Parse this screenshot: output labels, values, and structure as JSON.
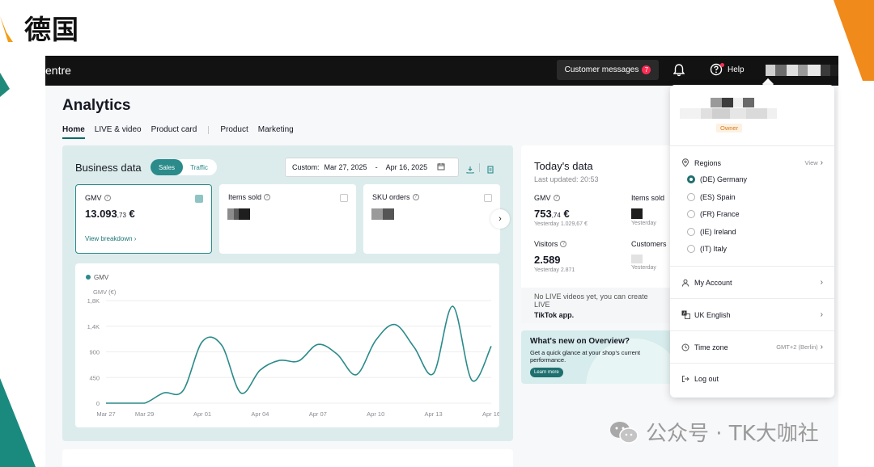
{
  "slide": {
    "title": "德国",
    "watermark": "公众号 · TK大咖社"
  },
  "topbar": {
    "brand_fragment": "entre",
    "customer_messages": "Customer messages",
    "message_count": "7",
    "help": "Help"
  },
  "page": {
    "title": "Analytics",
    "tabs": [
      {
        "label": "Home",
        "active": true
      },
      {
        "label": "LIVE & video",
        "active": false
      },
      {
        "label": "Product card",
        "active": false
      },
      {
        "label": "Product",
        "active": false
      },
      {
        "label": "Marketing",
        "active": false
      }
    ]
  },
  "business": {
    "title": "Business data",
    "toggle": [
      "Sales",
      "Traffic"
    ],
    "date_prefix": "Custom:",
    "date_start": "Mar 27, 2025",
    "date_sep": "-",
    "date_end": "Apr 16, 2025",
    "metrics": [
      {
        "label": "GMV",
        "value_main": "13.093",
        "value_dec": ",73",
        "value_unit": " €",
        "link": "View breakdown ›",
        "selected": true
      },
      {
        "label": "Items sold",
        "selected": false
      },
      {
        "label": "SKU orders",
        "selected": false
      }
    ]
  },
  "chart_data": {
    "type": "line",
    "legend": "GMV",
    "ylabel": "GMV (€)",
    "ylim": [
      0,
      1800
    ],
    "yticks": [
      "0",
      "450",
      "900",
      "1,4K",
      "1,8K"
    ],
    "ytick_values": [
      0,
      450,
      900,
      1350,
      1800
    ],
    "xticks": [
      "Mar 27",
      "Mar 29",
      "Apr 01",
      "Apr 04",
      "Apr 07",
      "Apr 10",
      "Apr 13",
      "Apr 16"
    ],
    "x": [
      "Mar 27",
      "Mar 28",
      "Mar 29",
      "Mar 30",
      "Mar 31",
      "Apr 01",
      "Apr 02",
      "Apr 03",
      "Apr 04",
      "Apr 05",
      "Apr 06",
      "Apr 07",
      "Apr 08",
      "Apr 09",
      "Apr 10",
      "Apr 11",
      "Apr 12",
      "Apr 13",
      "Apr 14",
      "Apr 15",
      "Apr 16"
    ],
    "series": [
      {
        "name": "GMV",
        "values": [
          0,
          0,
          0,
          180,
          220,
          1080,
          1020,
          180,
          580,
          750,
          740,
          1030,
          860,
          500,
          1100,
          1380,
          980,
          520,
          1700,
          400,
          1000
        ]
      }
    ],
    "color": "#2b8a8a"
  },
  "today": {
    "title": "Today's data",
    "updated": "Last updated: 20:53",
    "gmv_label": "GMV",
    "gmv_main": "753",
    "gmv_dec": ",74",
    "gmv_unit": " €",
    "gmv_yesterday": "Yesterday 1.029,67 €",
    "items_label": "Items sold",
    "items_yesterday": "Yesterday",
    "visitors_label": "Visitors",
    "visitors_value": "2.589",
    "visitors_yesterday": "Yesterday 2.871",
    "customers_label": "Customers",
    "customers_yesterday": "Yesterday",
    "foot_text": "No LIVE videos yet, you can create LIVE",
    "foot_bold": "TikTok app."
  },
  "whatsnew": {
    "title": "What's new on Overview?",
    "desc": "Get a quick glance at your shop's current performance.",
    "button": "Learn more"
  },
  "dropdown": {
    "role": "Owner",
    "regions_label": "Regions",
    "regions_view": "View",
    "regions": [
      {
        "label": "(DE) Germany",
        "selected": true
      },
      {
        "label": "(ES) Spain",
        "selected": false
      },
      {
        "label": "(FR) France",
        "selected": false
      },
      {
        "label": "(IE) Ireland",
        "selected": false
      },
      {
        "label": "(IT) Italy",
        "selected": false
      }
    ],
    "my_account": "My Account",
    "language": "UK English",
    "timezone_label": "Time zone",
    "timezone_value": "GMT+2 (Berlin)",
    "logout": "Log out"
  }
}
